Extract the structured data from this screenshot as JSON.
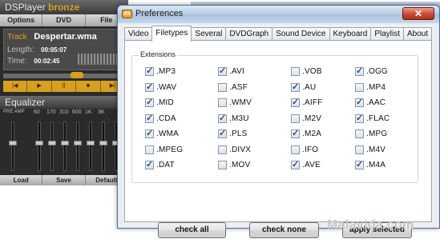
{
  "player": {
    "title_prefix": "DSPlayer",
    "title_suffix": "bronze",
    "menu": [
      "Options",
      "DVD",
      "File"
    ],
    "track_label": "Track",
    "track_value": "Despertar.wma",
    "length_label": "Length:",
    "length_value": "00:05:07",
    "time_label": "Time:",
    "time_value": "00:02:45",
    "controls": [
      "|◀",
      "▶",
      "||",
      "■",
      "▶|"
    ],
    "equalizer_title": "Equalizer",
    "eq_amp_label": "PRE AMP",
    "eq_bands": [
      "60",
      "170",
      "310",
      "600",
      "1K",
      "3K"
    ],
    "eq_buttons": [
      "Load",
      "Save",
      "Default"
    ]
  },
  "dialog": {
    "icon_text": "dS",
    "title": "Preferences",
    "close_label": "✕",
    "tabs": [
      {
        "label": "Video",
        "active": false
      },
      {
        "label": "Filetypes",
        "active": true
      },
      {
        "label": "Several",
        "active": false
      },
      {
        "label": "DVDGraph",
        "active": false
      },
      {
        "label": "Sound Device",
        "active": false
      },
      {
        "label": "Keyboard",
        "active": false
      },
      {
        "label": "Playlist",
        "active": false
      },
      {
        "label": "About",
        "active": false
      }
    ],
    "group_label": "Extensions",
    "extensions": [
      [
        {
          "label": ".MP3",
          "checked": true
        },
        {
          "label": ".WAV",
          "checked": true
        },
        {
          "label": ".MID",
          "checked": true
        },
        {
          "label": ".CDA",
          "checked": true
        },
        {
          "label": ".WMA",
          "checked": true
        },
        {
          "label": ".MPEG",
          "checked": false
        },
        {
          "label": ".DAT",
          "checked": true
        }
      ],
      [
        {
          "label": ".AVI",
          "checked": true
        },
        {
          "label": ".ASF",
          "checked": false
        },
        {
          "label": ".WMV",
          "checked": false
        },
        {
          "label": ".M3U",
          "checked": true
        },
        {
          "label": ".PLS",
          "checked": true
        },
        {
          "label": ".DIVX",
          "checked": false
        },
        {
          "label": ".MOV",
          "checked": false
        }
      ],
      [
        {
          "label": ".VOB",
          "checked": false
        },
        {
          "label": ".AU",
          "checked": true
        },
        {
          "label": ".AIFF",
          "checked": true
        },
        {
          "label": ".M2V",
          "checked": false
        },
        {
          "label": ".M2A",
          "checked": true
        },
        {
          "label": ".IFO",
          "checked": false
        },
        {
          "label": ".AVE",
          "checked": true
        }
      ],
      [
        {
          "label": ".OGG",
          "checked": true
        },
        {
          "label": ".MP4",
          "checked": false
        },
        {
          "label": ".AAC",
          "checked": true
        },
        {
          "label": ".FLAC",
          "checked": true
        },
        {
          "label": ".MPG",
          "checked": false
        },
        {
          "label": ".M4V",
          "checked": false
        },
        {
          "label": ".M4A",
          "checked": true
        }
      ]
    ],
    "buttons": {
      "check_all": "check all",
      "check_none": "check none",
      "apply_selected": "apply selected"
    }
  },
  "watermark": "Malavida.com"
}
